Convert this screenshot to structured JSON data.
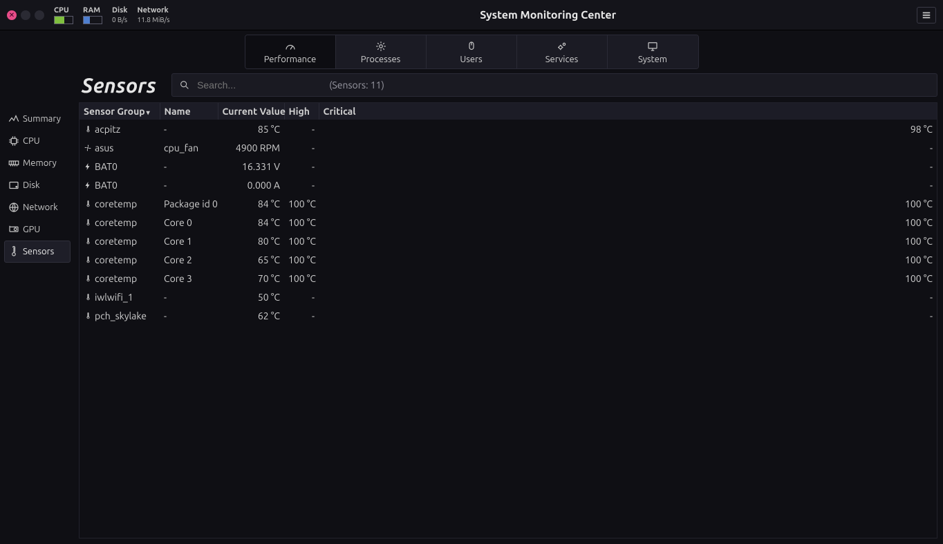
{
  "titlebar": {
    "title": "System Monitoring Center",
    "stats": {
      "cpu_label": "CPU",
      "ram_label": "RAM",
      "disk_label": "Disk",
      "disk_value": "0 B/s",
      "net_label": "Network",
      "net_value": "11.8 MiB/s"
    }
  },
  "main_tabs": [
    {
      "id": "performance",
      "label": "Performance",
      "active": true
    },
    {
      "id": "processes",
      "label": "Processes",
      "active": false
    },
    {
      "id": "users",
      "label": "Users",
      "active": false
    },
    {
      "id": "services",
      "label": "Services",
      "active": false
    },
    {
      "id": "system",
      "label": "System",
      "active": false
    }
  ],
  "sidebar": [
    {
      "id": "summary",
      "label": "Summary",
      "active": false
    },
    {
      "id": "cpu",
      "label": "CPU",
      "active": false
    },
    {
      "id": "memory",
      "label": "Memory",
      "active": false
    },
    {
      "id": "disk",
      "label": "Disk",
      "active": false
    },
    {
      "id": "network",
      "label": "Network",
      "active": false
    },
    {
      "id": "gpu",
      "label": "GPU",
      "active": false
    },
    {
      "id": "sensors",
      "label": "Sensors",
      "active": true
    }
  ],
  "panel": {
    "title": "Sensors",
    "search_placeholder": "Search...",
    "hint": "(Sensors: 11)"
  },
  "columns": {
    "group": "Sensor Group",
    "name": "Name",
    "value": "Current Value",
    "high": "High",
    "critical": "Critical"
  },
  "rows": [
    {
      "icon": "therm",
      "group": "acpitz",
      "name": "-",
      "value": "85 °C",
      "high": "-",
      "critical": "98 °C"
    },
    {
      "icon": "fan",
      "group": "asus",
      "name": "cpu_fan",
      "value": "4900 RPM",
      "high": "-",
      "critical": "-"
    },
    {
      "icon": "bolt",
      "group": "BAT0",
      "name": "-",
      "value": "16.331 V",
      "high": "-",
      "critical": "-"
    },
    {
      "icon": "bolt",
      "group": "BAT0",
      "name": "-",
      "value": "0.000 A",
      "high": "-",
      "critical": "-"
    },
    {
      "icon": "therm",
      "group": "coretemp",
      "name": "Package id 0",
      "value": "84 °C",
      "high": "100 °C",
      "critical": "100 °C"
    },
    {
      "icon": "therm",
      "group": "coretemp",
      "name": "Core 0",
      "value": "84 °C",
      "high": "100 °C",
      "critical": "100 °C"
    },
    {
      "icon": "therm",
      "group": "coretemp",
      "name": "Core 1",
      "value": "80 °C",
      "high": "100 °C",
      "critical": "100 °C"
    },
    {
      "icon": "therm",
      "group": "coretemp",
      "name": "Core 2",
      "value": "65 °C",
      "high": "100 °C",
      "critical": "100 °C"
    },
    {
      "icon": "therm",
      "group": "coretemp",
      "name": "Core 3",
      "value": "70 °C",
      "high": "100 °C",
      "critical": "100 °C"
    },
    {
      "icon": "therm",
      "group": "iwlwifi_1",
      "name": "-",
      "value": "50 °C",
      "high": "-",
      "critical": "-"
    },
    {
      "icon": "therm",
      "group": "pch_skylake",
      "name": "-",
      "value": "62 °C",
      "high": "-",
      "critical": "-"
    }
  ]
}
